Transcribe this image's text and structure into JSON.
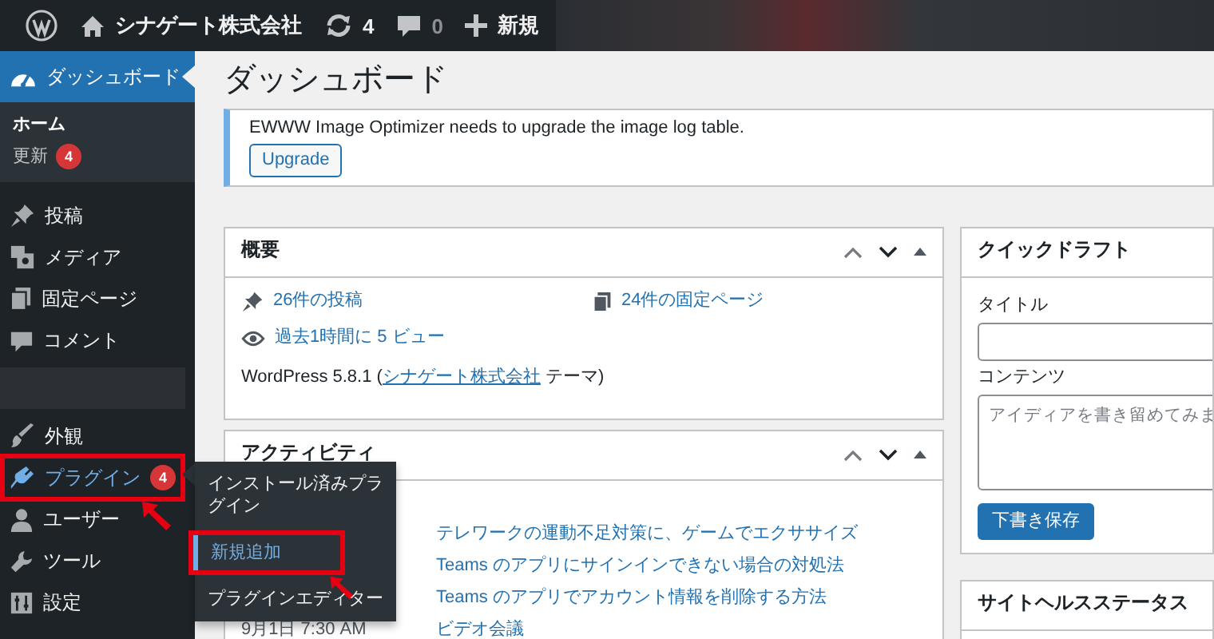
{
  "admin_bar": {
    "items": [
      {
        "kind": "logo"
      },
      {
        "kind": "home",
        "label": "シナゲート株式会社"
      },
      {
        "kind": "updates",
        "label": "4"
      },
      {
        "kind": "comments",
        "label": "0"
      },
      {
        "kind": "new",
        "label": "新規"
      },
      {
        "kind": "blurred"
      }
    ]
  },
  "sidebar": {
    "menu_top": [
      {
        "kind": "dashboard",
        "label": "ダッシュボード",
        "selected": true,
        "hovered": false,
        "annotated": false,
        "children": [
          {
            "label": "ホーム",
            "selected": true
          },
          {
            "label": "更新",
            "badge": "4",
            "selected": false
          }
        ]
      },
      {
        "kind": "posts",
        "label": "投稿",
        "selected": false,
        "hovered": false,
        "annotated": false
      },
      {
        "kind": "media",
        "label": "メディア",
        "selected": false,
        "hovered": false,
        "annotated": false
      },
      {
        "kind": "pages",
        "label": "固定ページ",
        "selected": false,
        "hovered": false,
        "annotated": false
      },
      {
        "kind": "comments",
        "label": "コメント",
        "selected": false,
        "hovered": false,
        "annotated": false
      }
    ],
    "menu_bottom": [
      {
        "kind": "appearance",
        "label": "外観",
        "selected": false,
        "hovered": false,
        "annotated": false
      },
      {
        "kind": "plugins",
        "label": "プラグイン",
        "badge": "4",
        "selected": false,
        "hovered": true,
        "annotated": true,
        "flyout": [
          {
            "label": "インストール済みプラグイン",
            "selected": false,
            "annotated": false
          },
          {
            "label": "新規追加",
            "selected": true,
            "annotated": true
          },
          {
            "label": "プラグインエディター",
            "selected": false,
            "annotated": false
          }
        ]
      },
      {
        "kind": "users",
        "label": "ユーザー",
        "selected": false,
        "hovered": false,
        "annotated": false
      },
      {
        "kind": "tools",
        "label": "ツール",
        "selected": false,
        "hovered": false,
        "annotated": false
      },
      {
        "kind": "settings",
        "label": "設定",
        "selected": false,
        "hovered": false,
        "annotated": false
      }
    ]
  },
  "page_title": "ダッシュボード",
  "notice": {
    "text": "EWWW Image Optimizer needs to upgrade the image log table.",
    "button": "Upgrade"
  },
  "overview": {
    "title": "概要",
    "items": [
      {
        "kind": "pin",
        "label": "26件の投稿"
      },
      {
        "kind": "pages",
        "label": "24件の固定ページ"
      },
      {
        "kind": "eye",
        "label": "過去1時間に 5 ビュー"
      }
    ],
    "footer_prefix": "WordPress 5.8.1 (",
    "footer_link": "シナゲート株式会社",
    "footer_suffix": " テーマ)"
  },
  "activity": {
    "title": "アクティビティ",
    "rows": [
      {
        "title": "テレワークの運動不足対策に、ゲームでエクササイズ"
      },
      {
        "title": "Teams のアプリにサインインできない場合の対処法"
      },
      {
        "title": "Teams のアプリでアカウント情報を削除する方法"
      },
      {
        "date": "9月1日 7:30 AM",
        "title": "ビデオ会議"
      }
    ]
  },
  "quick_draft": {
    "title": "クイックドラフト",
    "title_label": "タイトル",
    "content_label": "コンテンツ",
    "content_placeholder": "アイディアを書き留めてみま",
    "button": "下書き保存"
  },
  "site_health": {
    "title": "サイトヘルスステータス"
  }
}
